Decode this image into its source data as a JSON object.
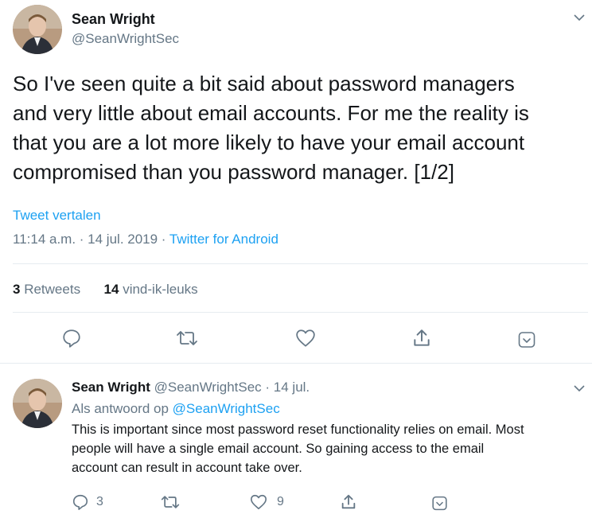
{
  "main_tweet": {
    "author_name": "Sean Wright",
    "author_handle": "@SeanWrightSec",
    "text_lines": [
      "So I've seen quite a bit said about password managers",
      "and very little about email accounts. For me the reality is",
      "that you are a lot more likely to have your email account",
      "compromised than you password manager. [1/2]"
    ],
    "translate_label": "Tweet vertalen",
    "timestamp": "11:14 a.m. · 14 jul. 2019 · ",
    "source": "Twitter for Android",
    "retweets_count": "3",
    "retweets_label": "Retweets",
    "likes_count": "14",
    "likes_label": "vind-ik-leuks"
  },
  "reply": {
    "author_name": "Sean Wright",
    "author_handle": "@SeanWrightSec",
    "date": "· 14 jul.",
    "reply_to_label": "Als antwoord op ",
    "reply_to_handle": "@SeanWrightSec",
    "text_lines": [
      "This is important since most password reset functionality relies on email. Most",
      "people will have a single email account. So gaining access to the email",
      "account can result in account take over."
    ],
    "reply_count": "3",
    "like_count": "9"
  },
  "icons": {
    "reply": "reply-icon",
    "retweet": "retweet-icon",
    "like": "heart-icon",
    "share": "share-icon",
    "more": "chevron-down-icon",
    "dm": "envelope-down-icon"
  },
  "colors": {
    "accent": "#1da1f2",
    "muted": "#657786",
    "text": "#14171a",
    "divider": "#e6ecf0"
  }
}
